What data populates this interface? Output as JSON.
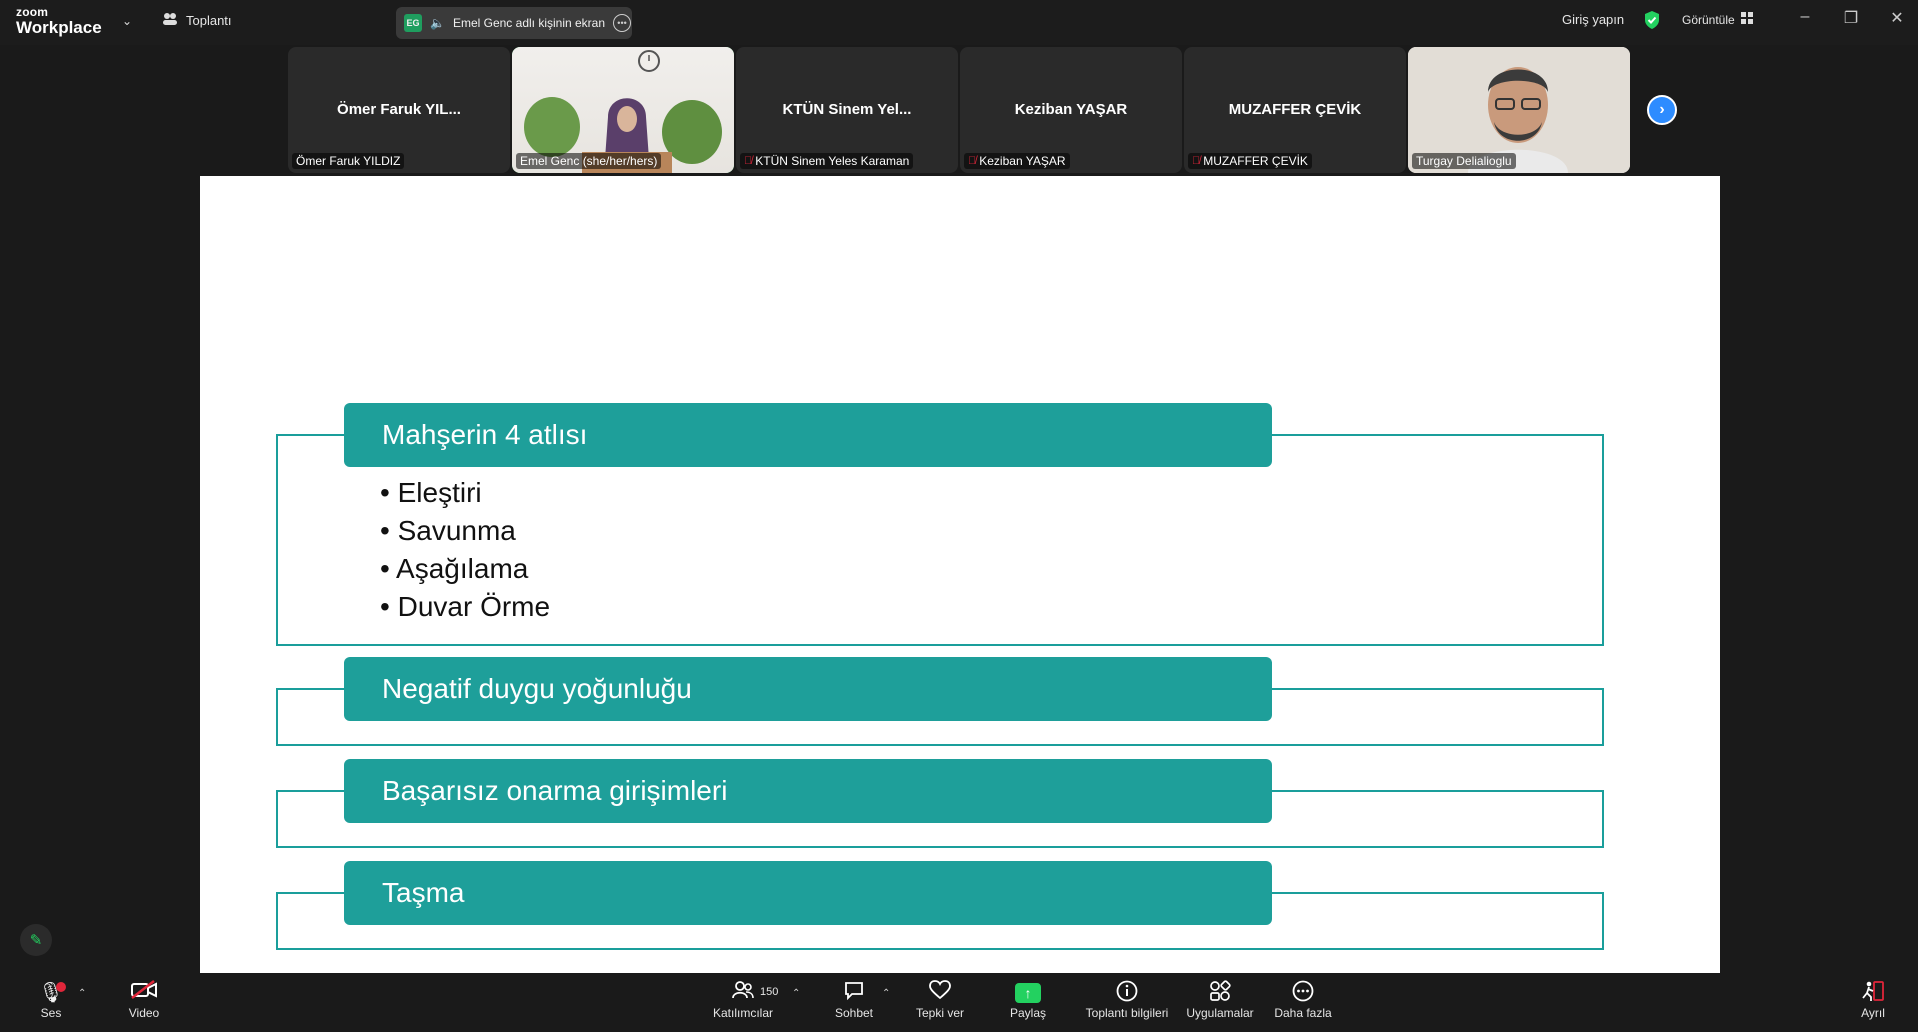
{
  "titlebar": {
    "logo_line1": "zoom",
    "logo_line2": "Workplace",
    "meeting_label": "Toplantı",
    "share_badge": "EG",
    "share_text": "Emel Genc adlı kişinin ekran",
    "signin": "Giriş yapın",
    "view_label": "Görüntüle"
  },
  "participants": [
    {
      "big_name": "Ömer Faruk YIL...",
      "label": "Ömer Faruk YILDIZ",
      "muted": false
    },
    {
      "big_name": "",
      "label": "Emel Genc (she/her/hers)",
      "muted": false
    },
    {
      "big_name": "KTÜN Sinem Yel...",
      "label": "KTÜN Sinem Yeles Karaman",
      "muted": true
    },
    {
      "big_name": "Keziban YAŞAR",
      "label": "Keziban YAŞAR",
      "muted": true
    },
    {
      "big_name": "MUZAFFER ÇEVİK",
      "label": "MUZAFFER ÇEVİK",
      "muted": true
    },
    {
      "big_name": "",
      "label": "Turgay Delialioglu",
      "muted": false
    }
  ],
  "slide": {
    "sections": [
      {
        "title": "Mahşerin 4 atlısı",
        "bullets": [
          "Eleştiri",
          "Savunma",
          "Aşağılama",
          "Duvar Örme"
        ]
      },
      {
        "title": "Negatif duygu yoğunluğu"
      },
      {
        "title": "Başarısız onarma girişimleri"
      },
      {
        "title": "Taşma"
      }
    ]
  },
  "toolbar": {
    "audio": "Ses",
    "video": "Video",
    "participants": "Katılımcılar",
    "participants_count": "150",
    "chat": "Sohbet",
    "react": "Tepki ver",
    "share": "Paylaş",
    "info": "Toplantı bilgileri",
    "apps": "Uygulamalar",
    "more": "Daha fazla",
    "leave": "Ayrıl"
  },
  "colors": {
    "teal": "#1e9f9a",
    "active_speaker": "#23d160",
    "mute_red": "#e0263a",
    "accent_blue": "#2d8cff"
  }
}
